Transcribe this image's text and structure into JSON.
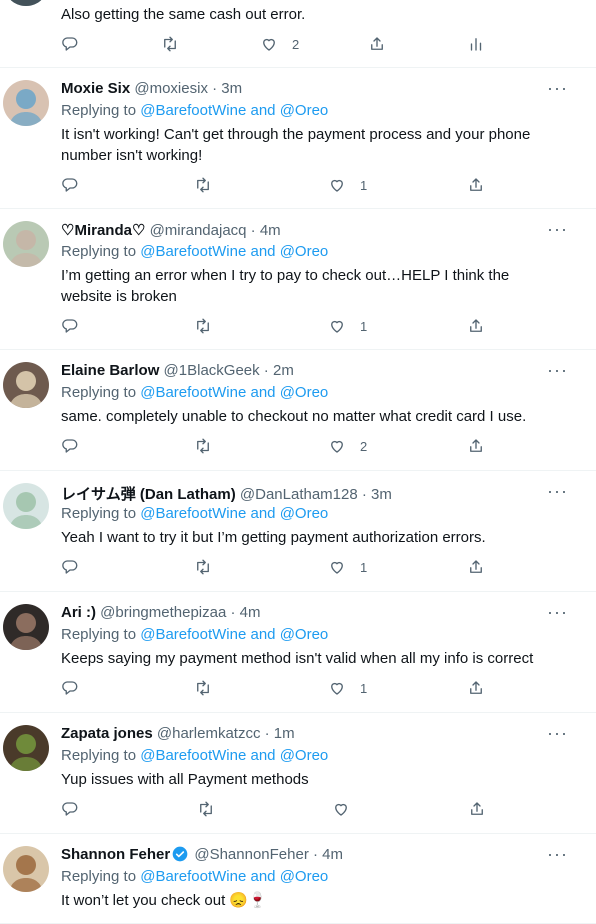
{
  "top_tweet": {
    "text": "Also getting the same cash out error.",
    "like_count": "2"
  },
  "replying_prefix": "Replying to ",
  "mention_1": "@BarefootWine",
  "and_word": " and ",
  "mention_2": "@Oreo",
  "tweets": [
    {
      "name": "Moxie Six",
      "meta": " @moxiesix · 3m",
      "text": "It isn't working!  Can't get through the payment process and your phone number isn't working!",
      "likes": "1"
    },
    {
      "name": "♡Miranda♡",
      "meta": " @mirandajacq · 4m",
      "text": "I’m getting an error when I try to pay to check out…HELP I think the website is broken",
      "likes": "1"
    },
    {
      "name": "Elaine Barlow",
      "meta": " @1BlackGeek · 2m",
      "text": "same. completely unable to checkout no matter what credit card I use.",
      "likes": "2"
    },
    {
      "name": "レイサム弾 (Dan Latham)",
      "meta": " @DanLatham128 · 3m",
      "text": "Yeah I want to try it but I’m getting payment authorization errors.",
      "likes": "1"
    },
    {
      "name": "Ari :)",
      "meta": " @bringmethepizaa · 4m",
      "text": "Keeps saying my payment method isn't valid when all my info is correct",
      "likes": "1"
    },
    {
      "name": "Zapata jones",
      "meta": " @harlemkatzcc · 1m",
      "text": "Yup issues with all Payment methods",
      "likes": ""
    },
    {
      "name": "Shannon Feher",
      "meta": " @ShannonFeher · 4m",
      "text": "It won’t let you check out 😞🍷",
      "likes": ""
    }
  ],
  "more_glyph": "···",
  "colors": {
    "link": "#1d9bf0",
    "secondary": "#536471",
    "verified": "#1d9bf0"
  },
  "icons": [
    "reply-icon",
    "retweet-icon",
    "like-icon",
    "share-icon",
    "analytics-icon",
    "more-icon",
    "verified-badge-icon"
  ]
}
